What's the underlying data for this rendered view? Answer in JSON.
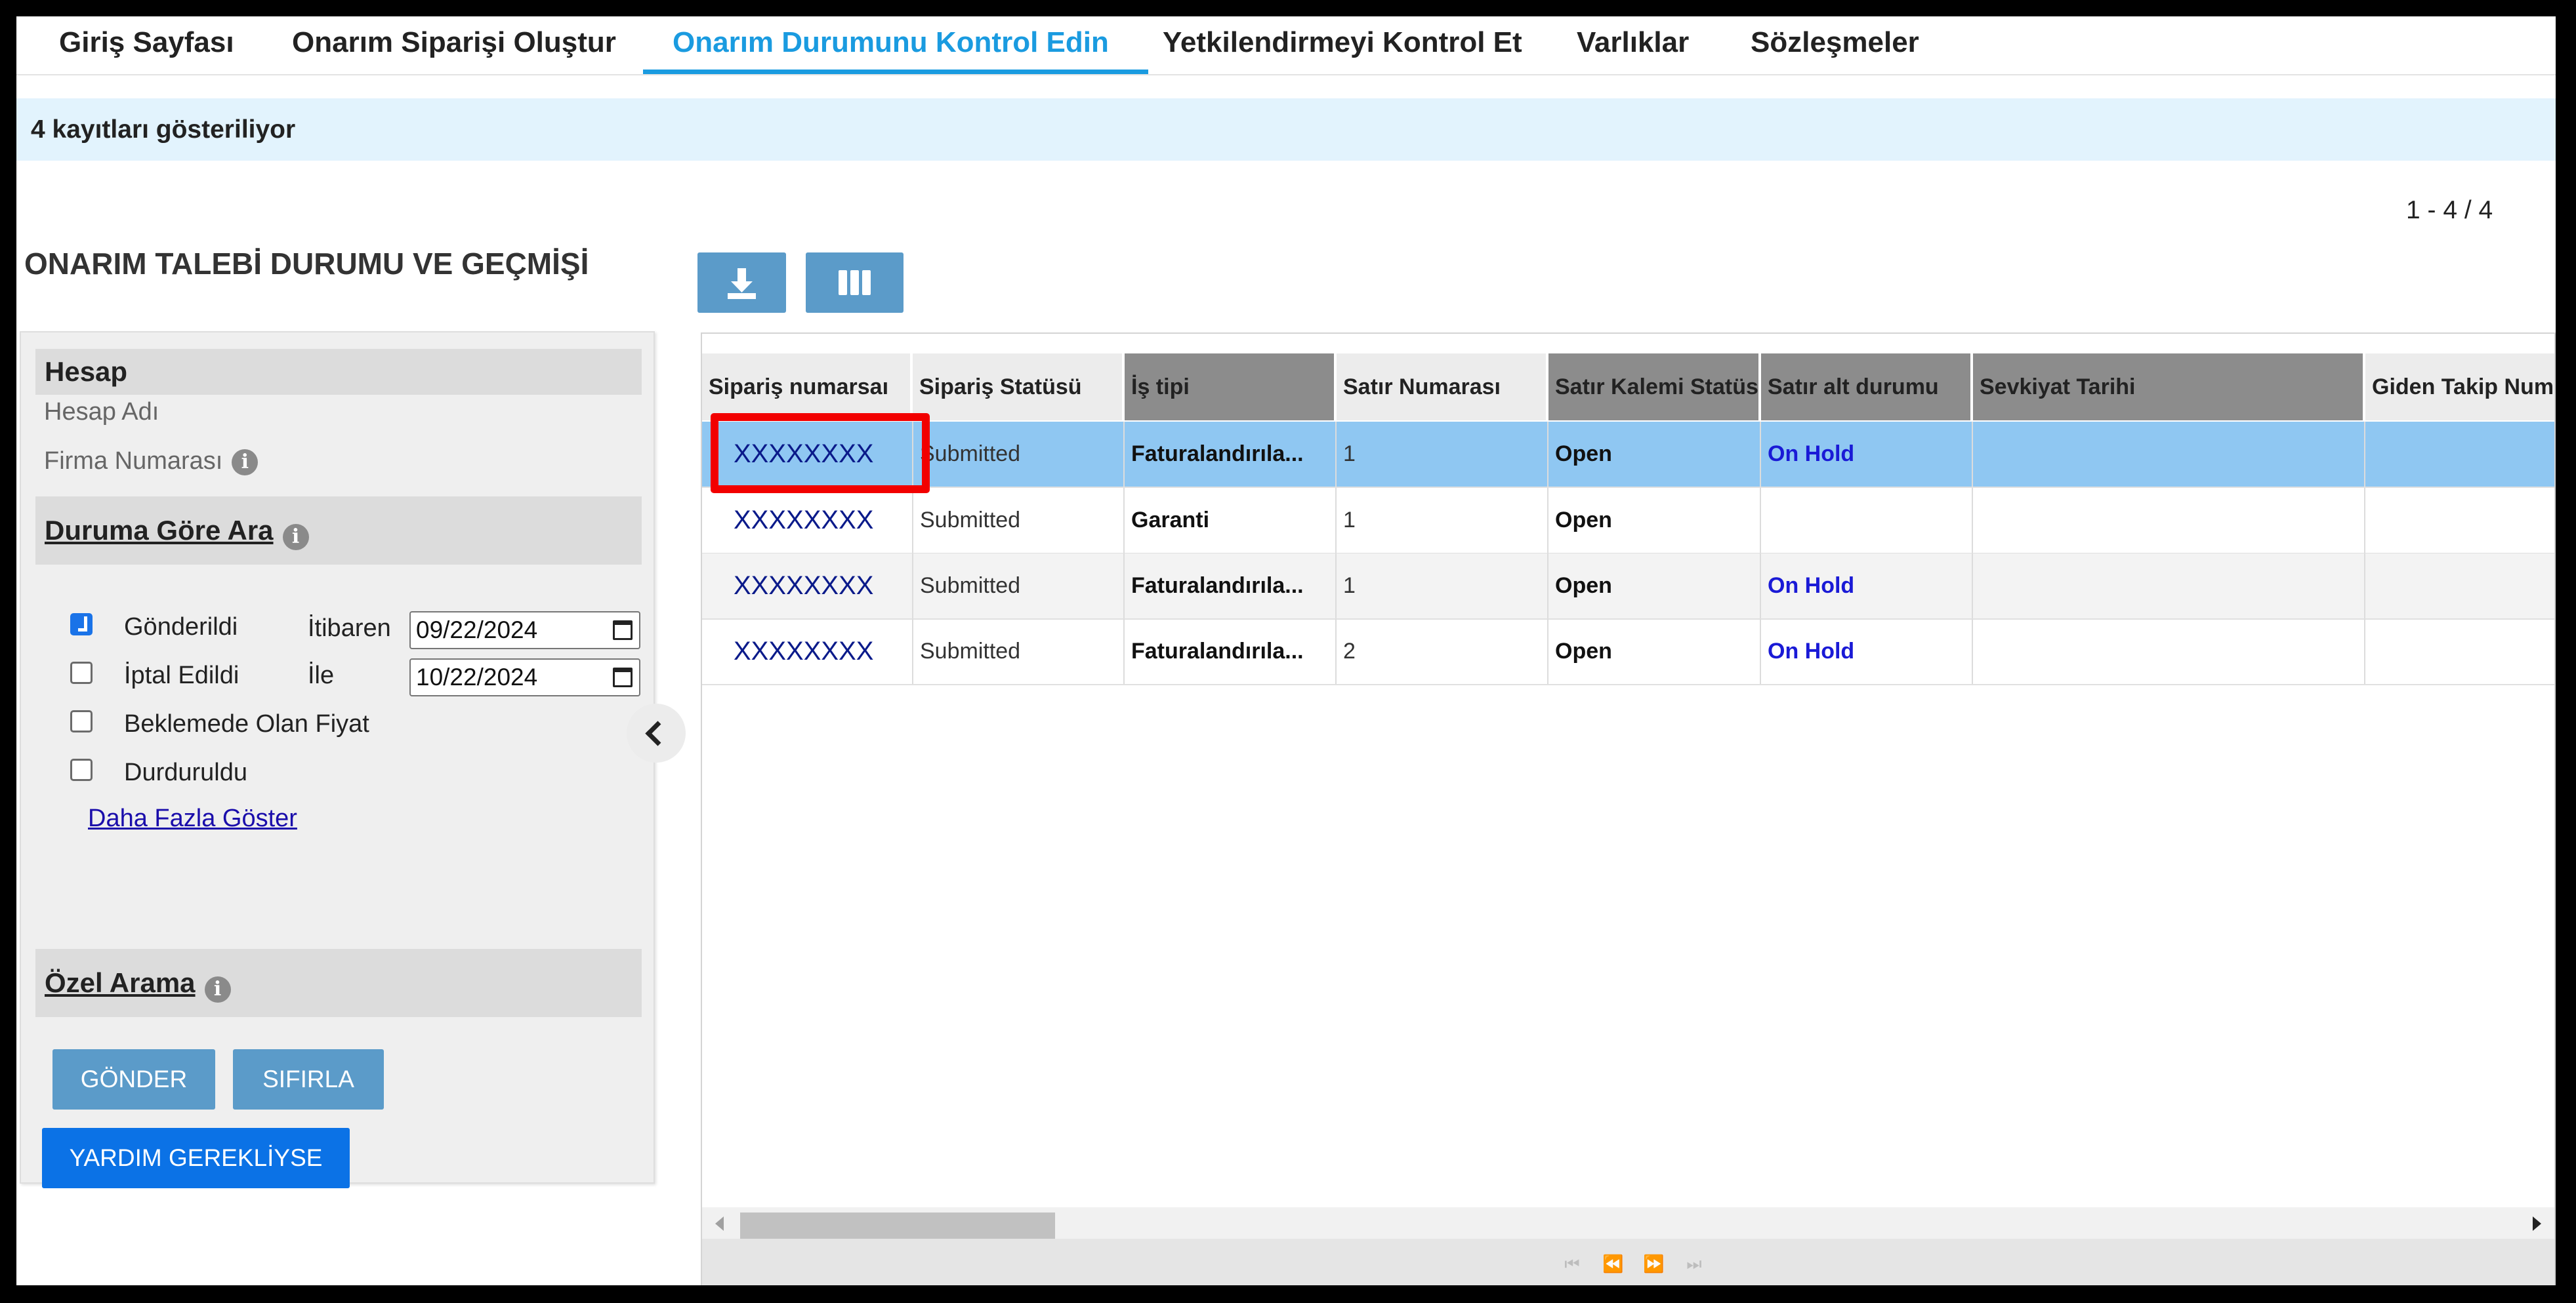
{
  "nav": {
    "tabs": [
      {
        "label": "Giriş Sayfası"
      },
      {
        "label": "Onarım Siparişi Oluştur"
      },
      {
        "label": "Onarım Durumunu Kontrol Edin"
      },
      {
        "label": "Yetkilendirmeyi Kontrol Et"
      },
      {
        "label": "Varlıklar"
      },
      {
        "label": "Sözleşmeler"
      }
    ],
    "active_tab": "Onarım Durumunu Kontrol Edin",
    "active_color": "#1a9be0"
  },
  "info_bar": {
    "text": "4 kayıtları gösteriliyor"
  },
  "page_title": "ONARIM TALEBİ DURUMU VE GEÇMİŞİ",
  "record_range": "1 - 4 / 4",
  "filters": {
    "account": {
      "title": "Hesap",
      "account_name_label": "Hesap Adı",
      "company_number_label": "Firma Numarası"
    },
    "status_search": {
      "title": "Duruma Göre Ara",
      "options": [
        {
          "label": "Gönderildi",
          "checked": true
        },
        {
          "label": "İptal Edildi",
          "checked": false
        },
        {
          "label": "Beklemede Olan Fiyat",
          "checked": false
        },
        {
          "label": "Durduruldu",
          "checked": false
        }
      ],
      "from_label": "İtibaren",
      "from_value": "09/22/2024",
      "to_label": "İle",
      "to_value": "10/22/2024",
      "show_more": "Daha Fazla Göster"
    },
    "custom_search": {
      "title": "Özel Arama"
    },
    "submit_label": "GÖNDER",
    "reset_label": "SIFIRLA",
    "help_label": "YARDIM GEREKLİYSE"
  },
  "toolbar": {
    "download_icon": "download-icon",
    "columns_icon": "columns-icon"
  },
  "grid": {
    "columns": [
      "Sipariş numarsaı",
      "Sipariş Statüsü",
      "İş tipi",
      "Satır Numarası",
      "Satır Kalemi Statüsü",
      "Satır alt durumu",
      "Sevkiyat Tarihi",
      "Giden Takip Numarası"
    ],
    "rows": [
      {
        "order": "XXXXXXXX",
        "status": "Submitted",
        "job_type": "Faturalandırıla...",
        "line": "1",
        "line_status": "Open",
        "line_sub": "On Hold",
        "ship_date": "",
        "tracking": ""
      },
      {
        "order": "XXXXXXXX",
        "status": "Submitted",
        "job_type": "Garanti",
        "line": "1",
        "line_status": "Open",
        "line_sub": "",
        "ship_date": "",
        "tracking": ""
      },
      {
        "order": "XXXXXXXX",
        "status": "Submitted",
        "job_type": "Faturalandırıla...",
        "line": "1",
        "line_status": "Open",
        "line_sub": "On Hold",
        "ship_date": "",
        "tracking": ""
      },
      {
        "order": "XXXXXXXX",
        "status": "Submitted",
        "job_type": "Faturalandırıla...",
        "line": "2",
        "line_status": "Open",
        "line_sub": "On Hold",
        "ship_date": "",
        "tracking": ""
      }
    ],
    "selected_row": 0
  },
  "colors": {
    "highlight": "#f20000",
    "selected_row": "#8fc7f2",
    "info_bar": "#e2f3fd",
    "primary_button": "#0b72e6",
    "secondary_button": "#5b9bc9",
    "on_hold_text": "#1a1ad6"
  }
}
